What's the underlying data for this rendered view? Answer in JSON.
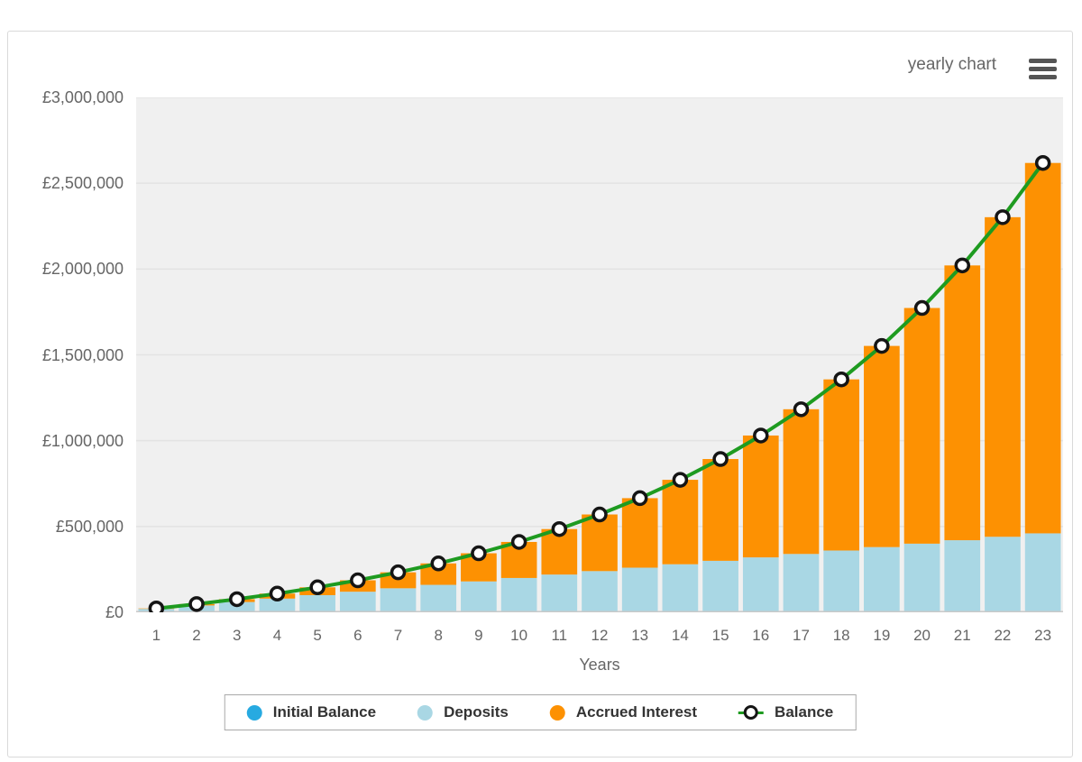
{
  "header": {
    "title": "yearly chart",
    "menu_icon": "hamburger-icon"
  },
  "colors": {
    "initial_balance": "#27aae1",
    "deposits": "#a9d7e4",
    "accrued_interest": "#fd9102",
    "balance_line": "#1e9b20",
    "marker_fill": "#ffffff",
    "marker_stroke": "#151515",
    "plot_bg": "#f0f0f0",
    "gridline": "#e3e3e3",
    "axis_line": "#c9c9c9",
    "axis_text": "#666666",
    "legend_text": "#333333"
  },
  "chart_data": {
    "type": "bar",
    "stacked": true,
    "grid": true,
    "legend_position": "bottom",
    "xlabel": "Years",
    "ylabel": "",
    "ylim": [
      0,
      3000000
    ],
    "categories": [
      1,
      2,
      3,
      4,
      5,
      6,
      7,
      8,
      9,
      10,
      11,
      12,
      13,
      14,
      15,
      16,
      17,
      18,
      19,
      20,
      21,
      22,
      23
    ],
    "yticks": [
      {
        "value": 0,
        "label": "£0"
      },
      {
        "value": 500000,
        "label": "£500,000"
      },
      {
        "value": 1000000,
        "label": "£1,000,000"
      },
      {
        "value": 1500000,
        "label": "£1,500,000"
      },
      {
        "value": 2000000,
        "label": "£2,000,000"
      },
      {
        "value": 2500000,
        "label": "£2,500,000"
      },
      {
        "value": 3000000,
        "label": "£3,000,000"
      }
    ],
    "series": [
      {
        "name": "Initial Balance",
        "kind": "bar",
        "color_key": "initial_balance",
        "values": [
          0,
          0,
          0,
          0,
          0,
          0,
          0,
          0,
          0,
          0,
          0,
          0,
          0,
          0,
          0,
          0,
          0,
          0,
          0,
          0,
          0,
          0,
          0
        ]
      },
      {
        "name": "Deposits",
        "kind": "bar",
        "color_key": "deposits",
        "values": [
          20000,
          40000,
          60000,
          80000,
          100000,
          120000,
          140000,
          160000,
          180000,
          200000,
          220000,
          240000,
          260000,
          280000,
          300000,
          320000,
          340000,
          360000,
          380000,
          400000,
          420000,
          440000,
          460000
        ]
      },
      {
        "name": "Accrued Interest",
        "kind": "bar",
        "color_key": "accrued_interest",
        "values": [
          2500,
          8000,
          16500,
          29000,
          45500,
          66500,
          93000,
          125000,
          164000,
          210000,
          265000,
          330000,
          405000,
          492000,
          593000,
          710000,
          843000,
          997000,
          1172000,
          1373000,
          1601000,
          1862000,
          2158000
        ]
      },
      {
        "name": "Balance",
        "kind": "line",
        "color_key": "balance_line",
        "values": [
          22500,
          48000,
          76500,
          109000,
          145500,
          186500,
          233000,
          285000,
          344000,
          410000,
          485000,
          570000,
          665000,
          772000,
          893000,
          1030000,
          1183000,
          1357000,
          1552000,
          1773000,
          2021000,
          2302000,
          2618000
        ]
      }
    ]
  }
}
